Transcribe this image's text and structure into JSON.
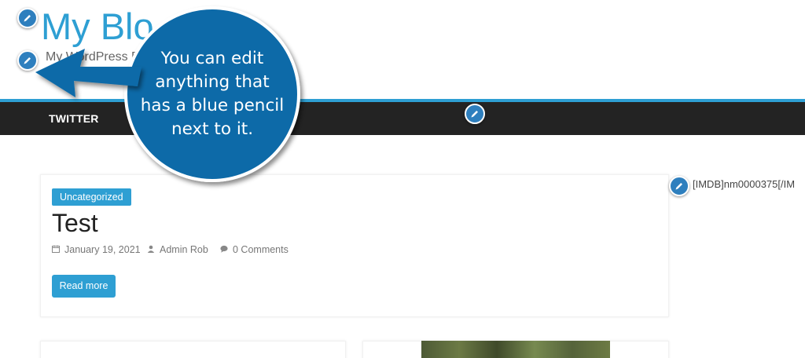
{
  "header": {
    "site_title": "My Blo",
    "tagline": "My WordPress B"
  },
  "nav": {
    "items": [
      {
        "label": "TWITTER"
      }
    ]
  },
  "post": {
    "category": "Uncategorized",
    "title": "Test",
    "date": "January 19, 2021",
    "author": "Admin Rob",
    "comments": "0 Comments",
    "read_more_label": "Read more"
  },
  "sidebar": {
    "widget_text": "[IMDB]nm0000375[/IM"
  },
  "callout": {
    "lines": [
      "You can edit",
      "anything that",
      "has a blue pencil",
      "next to it."
    ]
  },
  "colors": {
    "accent": "#2e9fd3",
    "pencil": "#2e7fbe",
    "nav_background": "#232323",
    "callout": "#0d6aa8"
  },
  "icons": {
    "edit": "pencil-icon",
    "date": "calendar-icon",
    "author": "user-icon",
    "comments": "comment-icon"
  }
}
